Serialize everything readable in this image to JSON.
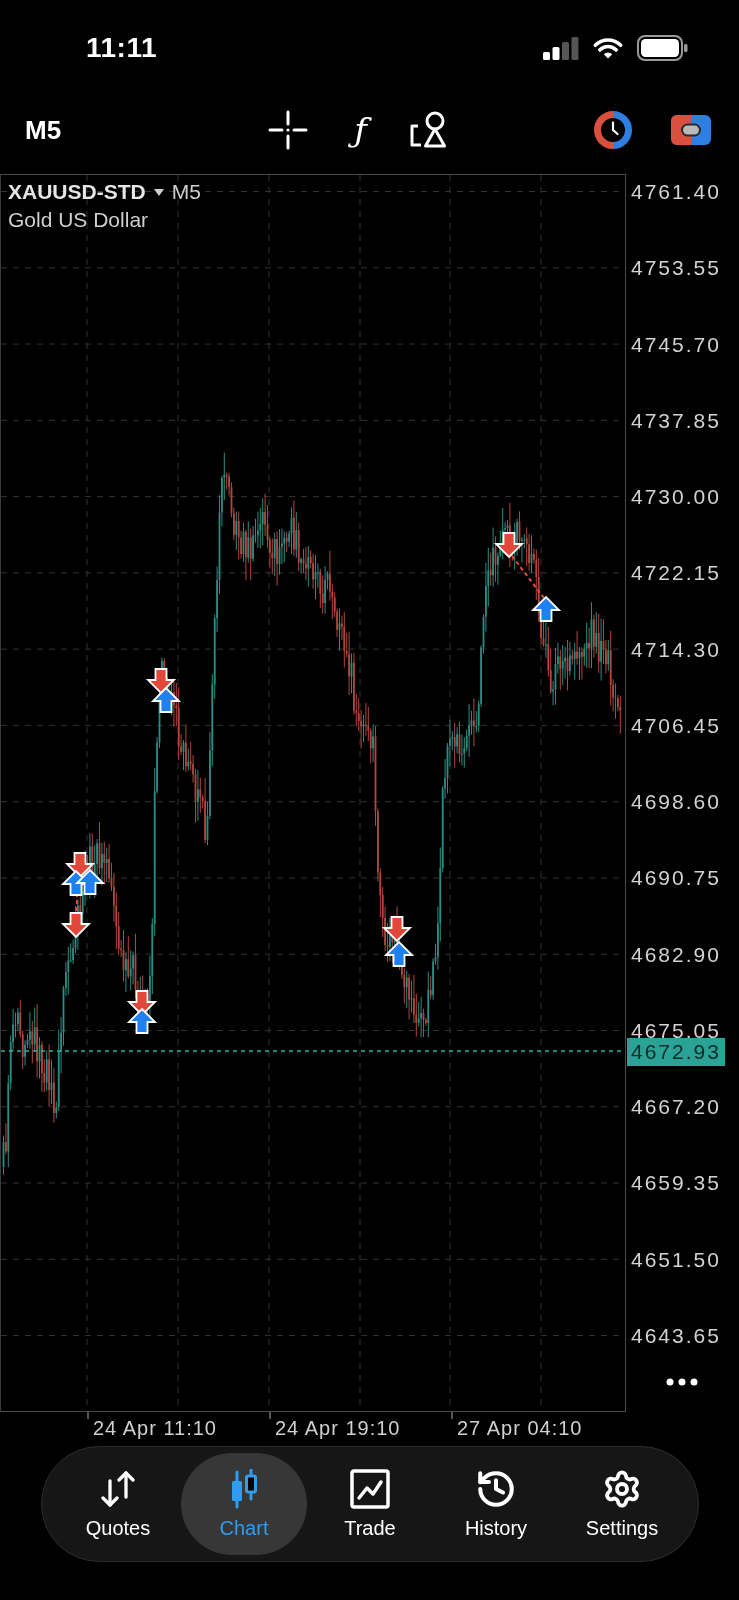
{
  "status_bar": {
    "time": "11:11"
  },
  "toolbar": {
    "timeframe": "M5",
    "function_glyph": "ƒ"
  },
  "chart": {
    "symbol": "XAUUSD-STD",
    "timeframe": "M5",
    "description": "Gold US Dollar",
    "price_labels": [
      "4761.40",
      "4753.55",
      "4745.70",
      "4737.85",
      "4730.00",
      "4722.15",
      "4714.30",
      "4706.45",
      "4698.60",
      "4690.75",
      "4682.90",
      "4675.05",
      "4667.20",
      "4659.35",
      "4651.50",
      "4643.65"
    ],
    "current_price": "4672.93",
    "time_labels": [
      "24 Apr 11:10",
      "24 Apr 19:10",
      "27 Apr 04:10"
    ]
  },
  "nav": [
    {
      "label": "Quotes",
      "selected": false
    },
    {
      "label": "Chart",
      "selected": true
    },
    {
      "label": "Trade",
      "selected": false
    },
    {
      "label": "History",
      "selected": false
    },
    {
      "label": "Settings",
      "selected": false
    }
  ]
}
